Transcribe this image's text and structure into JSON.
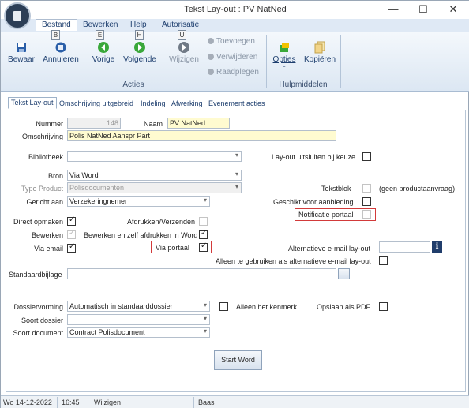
{
  "window": {
    "title": "Tekst Lay-out : PV NatNed",
    "min": "—",
    "max": "☐",
    "close": "✕"
  },
  "menu": {
    "items": [
      "Bestand",
      "Bewerken",
      "Help",
      "Autorisatie"
    ]
  },
  "ribbon": {
    "keytips": [
      "B",
      "E",
      "H",
      "U"
    ],
    "buttons": [
      "Bewaar",
      "Annuleren",
      "Vorige",
      "Volgende",
      "Wijzigen"
    ],
    "small": [
      "Toevoegen",
      "Verwijderen",
      "Raadplegen"
    ],
    "group_acties": "Acties",
    "opties": "Opties",
    "opties_sub": "-",
    "kopieren": "Kopiëren",
    "group_hulp": "Hulpmiddelen"
  },
  "tabs": [
    "Tekst Lay-out",
    "Omschrijving uitgebreid",
    "Indeling",
    "Afwerking",
    "Evenement acties"
  ],
  "form": {
    "nummer_label": "Nummer",
    "nummer_value": "148",
    "naam_label": "Naam",
    "naam_value": "PV NatNed",
    "omschrijving_label": "Omschrijving",
    "omschrijving_value": "Polis NatNed Aanspr Part",
    "bibliotheek_label": "Bibliotheek",
    "bibliotheek_value": "",
    "layout_uitsluiten_label": "Lay-out uitsluiten bij keuze",
    "bron_label": "Bron",
    "bron_value": "Via Word",
    "type_product_label": "Type Product",
    "type_product_value": "Polisdocumenten",
    "tekstblok_label": "Tekstblok",
    "geen_product_label": "(geen productaanvraag)",
    "gericht_aan_label": "Gericht aan",
    "gericht_aan_value": "Verzekeringnemer",
    "geschikt_label": "Geschikt voor aanbieding",
    "notificatie_label": "Notificatie portaal",
    "direct_opmaken_label": "Direct opmaken",
    "afdrukken_label": "Afdrukken/Verzenden",
    "bewerken_label": "Bewerken",
    "bewerken_zelf_label": "Bewerken en zelf afdrukken in Word",
    "via_email_label": "Via email",
    "via_portaal_label": "Via portaal",
    "alt_email_label": "Alternatieve e-mail lay-out",
    "alt_email_value": "",
    "info_icon_text": "i",
    "alleen_alt_label": "Alleen te gebruiken als alternatieve e-mail lay-out",
    "standaardbijlage_label": "Standaardbijlage",
    "standaardbijlage_value": "",
    "browse_label": "...",
    "dossiervorming_label": "Dossiervorming",
    "dossiervorming_value": "Automatisch in standaarddossier",
    "alleen_kenmerk_label": "Alleen het kenmerk",
    "opslaan_pdf_label": "Opslaan als PDF",
    "soort_dossier_label": "Soort dossier",
    "soort_dossier_value": "",
    "soort_document_label": "Soort document",
    "soort_document_value": "Contract Polisdocument",
    "start_word_label": "Start Word"
  },
  "status": {
    "date": "Wo 14-12-2022",
    "time": "16:45",
    "mode": "Wijzigen",
    "user": "Baas"
  }
}
